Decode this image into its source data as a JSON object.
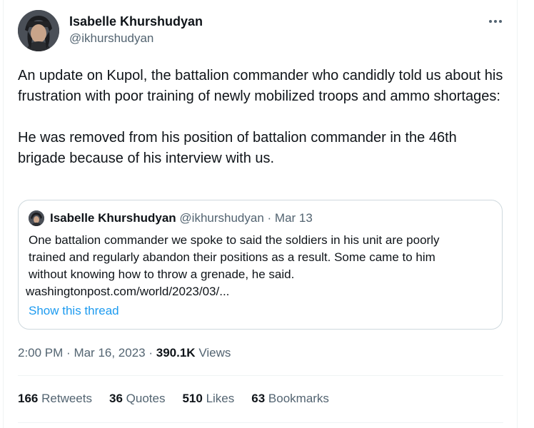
{
  "author": {
    "name": "Isabelle Khurshudyan",
    "handle": "@ikhurshudyan"
  },
  "more_icon": "more-horizontal-icon",
  "tweet": {
    "text": "An update on Kupol, the battalion commander who candidly told us about his frustration with poor training of newly mobilized troops and ammo shortages:\n\nHe was removed from his position of battalion commander in the 46th brigade because of his interview with us."
  },
  "quote": {
    "name": "Isabelle Khurshudyan",
    "handle": "@ikhurshudyan",
    "separator": " · ",
    "date": "Mar 13",
    "lines": [
      "One battalion commander we spoke to said the soldiers in his unit are poorly",
      "trained and regularly abandon their positions as a result. Some came to him",
      "without knowing how to throw a grenade, he said."
    ],
    "link": "washingtonpost.com/world/2023/03/...",
    "show_thread": "Show this thread"
  },
  "meta": {
    "time": "2:00 PM",
    "date": "Mar 16, 2023",
    "views_count": "390.1K",
    "views_label": "Views"
  },
  "stats": {
    "retweets_count": "166",
    "retweets_label": "Retweets",
    "quotes_count": "36",
    "quotes_label": "Quotes",
    "likes_count": "510",
    "likes_label": "Likes",
    "bookmarks_count": "63",
    "bookmarks_label": "Bookmarks"
  }
}
